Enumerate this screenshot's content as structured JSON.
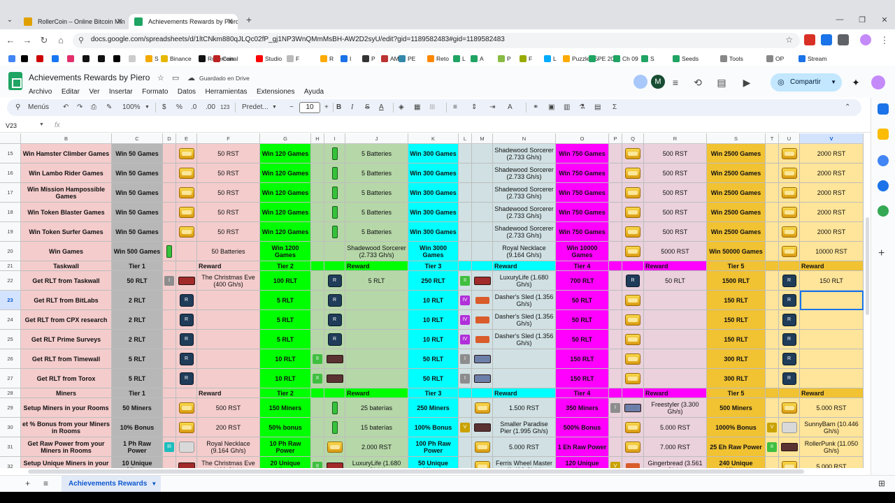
{
  "browser": {
    "tabs": [
      {
        "title": "RollerCoin – Online Bitcoin Min"
      },
      {
        "title": "Achievements Rewards by Piero"
      }
    ],
    "url": "docs.google.com/spreadsheets/d/1ltCNkm880qJLQc02fP_gj1NP3WnQMmMsBH-AW2D2syU/edit?gid=1189582483#gid=1189582483",
    "bookmarks": [
      "S",
      "Binance",
      "Rollercoin",
      "Canal",
      "Studio",
      "F",
      "R",
      "I",
      "P",
      "AM",
      "PE",
      "Reto",
      "L",
      "A",
      "P",
      "F",
      "L",
      "Puzzle 95",
      "PE 208",
      "Ch 09",
      "S",
      "Seeds",
      "Tools",
      "OP",
      "Stream"
    ]
  },
  "doc": {
    "title": "Achievements Rewards by Piero",
    "saved_status": "Guardado en Drive",
    "menu": [
      "Archivo",
      "Editar",
      "Ver",
      "Insertar",
      "Formato",
      "Datos",
      "Herramientas",
      "Extensiones",
      "Ayuda"
    ],
    "share_label": "Compartir",
    "avatar_letter": "M"
  },
  "toolbar": {
    "menus_label": "Menús",
    "zoom": "100%",
    "currency": "$",
    "percent": "%",
    "dec_less": ".0",
    "dec_more": ".00",
    "number_format": "123",
    "font": "Predet...",
    "font_size": "10"
  },
  "formula": {
    "name_box": "V23",
    "fx": "fx"
  },
  "grid": {
    "columns": [
      "B",
      "C",
      "D",
      "E",
      "F",
      "G",
      "H",
      "I",
      "J",
      "K",
      "L",
      "M",
      "N",
      "O",
      "P",
      "Q",
      "R",
      "S",
      "T",
      "U",
      "V"
    ],
    "selected_column": "V",
    "selected_row": "23",
    "rows": [
      {
        "num": "15",
        "B": "Win Hamster Climber Games",
        "C": "Win 50 Games",
        "F": "50 RST",
        "G": "Win 120 Games",
        "J": "5 Batteries",
        "K": "Win 300 Games",
        "N": "Shadewood Sorcerer (2.733 Gh/s)",
        "O": "Win 750 Games",
        "R": "500 RST",
        "S": "Win 2500 Games",
        "V": "2000 RST"
      },
      {
        "num": "16",
        "B": "Win Lambo Rider Games",
        "C": "Win 50 Games",
        "F": "50 RST",
        "G": "Win 120 Games",
        "J": "5 Batteries",
        "K": "Win 300 Games",
        "N": "Shadewood Sorcerer (2.733 Gh/s)",
        "O": "Win 750 Games",
        "R": "500 RST",
        "S": "Win 2500 Games",
        "V": "2000 RST"
      },
      {
        "num": "17",
        "B": "Win Mission Hampossible Games",
        "C": "Win 50 Games",
        "F": "50 RST",
        "G": "Win 120 Games",
        "J": "5 Batteries",
        "K": "Win 300 Games",
        "N": "Shadewood Sorcerer (2.733 Gh/s)",
        "O": "Win 750 Games",
        "R": "500 RST",
        "S": "Win 2500 Games",
        "V": "2000 RST"
      },
      {
        "num": "18",
        "B": "Win Token Blaster Games",
        "C": "Win 50 Games",
        "F": "50 RST",
        "G": "Win 120 Games",
        "J": "5 Batteries",
        "K": "Win 300 Games",
        "N": "Shadewood Sorcerer (2.733 Gh/s)",
        "O": "Win 750 Games",
        "R": "500 RST",
        "S": "Win 2500 Games",
        "V": "2000 RST"
      },
      {
        "num": "19",
        "B": "Win Token Surfer Games",
        "C": "Win 50 Games",
        "F": "50 RST",
        "G": "Win 120 Games",
        "J": "5 Batteries",
        "K": "Win 300 Games",
        "N": "Shadewood Sorcerer (2.733 Gh/s)",
        "O": "Win 750 Games",
        "R": "500 RST",
        "S": "Win 2500 Games",
        "V": "2000 RST"
      },
      {
        "num": "20",
        "B": "Win Games",
        "C": "Win 500 Games",
        "F": "50 Batteries",
        "G": "Win 1200 Games",
        "J": "Shadewood Sorcerer (2.733 Gh/s)",
        "K": "Win 3000 Games",
        "N": "Royal Necklace (9.164 Gh/s)",
        "O": "Win 10000 Games",
        "R": "5000 RST",
        "S": "Win 50000 Games",
        "V": "10000 RST"
      },
      {
        "num": "21",
        "B": "Taskwall",
        "C": "Tier 1",
        "F": "Reward",
        "G": "Tier 2",
        "J": "Reward",
        "K": "Tier 3",
        "N": "Reward",
        "O": "Tier 4",
        "R": "Reward",
        "S": "Tier 5",
        "V": "Reward"
      },
      {
        "num": "22",
        "B": "Get RLT from Taskwall",
        "C": "50 RLT",
        "F": "The Christmas Eve (400 Gh/s)",
        "G": "100 RLT",
        "J": "5 RLT",
        "K": "250 RLT",
        "N": "LuxuryLife (1.680 Gh/s)",
        "O": "700 RLT",
        "R": "50 RLT",
        "S": "1500 RLT",
        "V": "150 RLT"
      },
      {
        "num": "23",
        "B": "Get RLT from BitLabs",
        "C": "2 RLT",
        "F": "",
        "G": "5 RLT",
        "J": "",
        "K": "10 RLT",
        "N": "Dasher's Sled (1.356 Gh/s)",
        "O": "50 RLT",
        "R": "",
        "S": "150 RLT",
        "V": ""
      },
      {
        "num": "24",
        "B": "Get RLT from CPX research",
        "C": "2 RLT",
        "F": "",
        "G": "5 RLT",
        "J": "",
        "K": "10 RLT",
        "N": "Dasher's Sled (1.356 Gh/s)",
        "O": "50 RLT",
        "R": "",
        "S": "150 RLT",
        "V": ""
      },
      {
        "num": "25",
        "B": "Get RLT Prime Surveys",
        "C": "2 RLT",
        "F": "",
        "G": "5 RLT",
        "J": "",
        "K": "10 RLT",
        "N": "Dasher's Sled (1.356 Gh/s)",
        "O": "50 RLT",
        "R": "",
        "S": "150 RLT",
        "V": ""
      },
      {
        "num": "26",
        "B": "Get RLT from Timewall",
        "C": "5 RLT",
        "F": "",
        "G": "10 RLT",
        "J": "",
        "K": "50 RLT",
        "N": "",
        "O": "150 RLT",
        "R": "",
        "S": "300 RLT",
        "V": ""
      },
      {
        "num": "27",
        "B": "Get RLT from Torox",
        "C": "5 RLT",
        "F": "",
        "G": "10 RLT",
        "J": "",
        "K": "50 RLT",
        "N": "",
        "O": "150 RLT",
        "R": "",
        "S": "300 RLT",
        "V": ""
      },
      {
        "num": "28",
        "B": "Miners",
        "C": "Tier 1",
        "F": "Reward",
        "G": "Tier 2",
        "J": "Reward",
        "K": "Tier 3",
        "N": "Reward",
        "O": "Tier 4",
        "R": "Reward",
        "S": "Tier 5",
        "V": "Reward"
      },
      {
        "num": "29",
        "B": "Setup Miners in your Rooms",
        "C": "50 Miners",
        "F": "500 RST",
        "G": "150 Miners",
        "J": "25 baterías",
        "K": "250 Miners",
        "N": "1.500 RST",
        "O": "350 Miners",
        "R": "Freestyler (3.300 Gh/s)",
        "S": "500 Miners",
        "V": "5.000 RST"
      },
      {
        "num": "30",
        "B": "et % Bonus from your Miners in Rooms",
        "C": "10% Bonus",
        "F": "200 RST",
        "G": "50% bonus",
        "J": "15 baterías",
        "K": "100% Bonus",
        "N": "Smaller Paradise Pier (1.995 Gh/s)",
        "O": "500% Bonus",
        "R": "5.000 RST",
        "S": "1000% Bonus",
        "V": "SunnyBarn (10.446 Gh/s)"
      },
      {
        "num": "31",
        "B": "Get Raw Power from your Miners in Rooms",
        "C": "1 Ph Raw Power",
        "F": "Royal Necklace (9.164 Gh/s)",
        "G": "10 Ph Raw Power",
        "J": "2.000 RST",
        "K": "100 Ph Raw Power",
        "N": "5.000 RST",
        "O": "1 Eh Raw Power",
        "R": "7.000 RST",
        "S": "25 Eh Raw Power",
        "V": "RollerPunk (11.050 Gh/s)"
      },
      {
        "num": "32",
        "B": "Setup Unique Miners in your Rooms",
        "C": "10 Unique Miners",
        "F": "The Christmas Eve (400 Gh/s)",
        "G": "20 Unique Miners",
        "J": "LuxuryLife (1.680 Gh/s)",
        "K": "50 Unique Miners",
        "N": "Ferris Wheel Master (1.403 Gh/s)",
        "O": "120 Unique Miners",
        "R": "Gingerbread (3.561 Gh/s)",
        "S": "240 Unique Miners",
        "V": "5.000 RST"
      }
    ]
  },
  "sheet_tabs": [
    {
      "label": "Achievements Rewards"
    }
  ],
  "colors": {
    "col_B": "#f4cccc",
    "col_C": "#b7b7b7",
    "col_E": "#f4cccc",
    "col_F": "#f4cccc",
    "col_G": "#00ff00",
    "col_J": "#b6d7a8",
    "col_K": "#00ffff",
    "col_N": "#d0e0e3",
    "col_O": "#ff00ff",
    "col_R": "#ead1dc",
    "col_S": "#f1c232",
    "col_V": "#ffe599",
    "section_B": "#f4cccc",
    "section_C": "#b7b7b7",
    "section_F": "#f4cccc",
    "section_G": "#00ff00",
    "section_J": "#00ff00",
    "section_K": "#00ffff",
    "section_N": "#00ffff",
    "section_O": "#ff00ff",
    "section_R": "#ff00ff",
    "section_S": "#f1c232",
    "section_V": "#f1c232"
  }
}
